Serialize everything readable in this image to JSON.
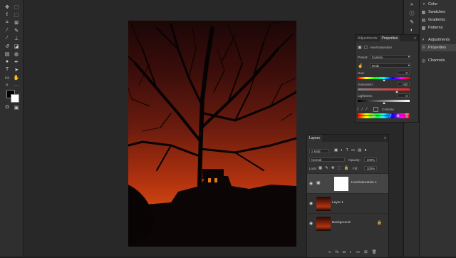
{
  "toolbar": {
    "tools": [
      "move",
      "marquee",
      "lasso",
      "object-select",
      "crop",
      "frame",
      "eyedropper",
      "healing",
      "brush",
      "stamp",
      "history-brush",
      "eraser",
      "gradient",
      "blur",
      "dodge",
      "pen",
      "type",
      "path-select",
      "rectangle",
      "hand",
      "zoom",
      "more"
    ]
  },
  "dock_strip": {
    "icons": [
      "collapse",
      "info",
      "brush-panel",
      "adjust",
      "layer-comps"
    ]
  },
  "dock": {
    "items": [
      {
        "label": "Color",
        "icon": "color-icon"
      },
      {
        "label": "Swatches",
        "icon": "swatches-icon"
      },
      {
        "label": "Gradients",
        "icon": "gradients-icon"
      },
      {
        "label": "Patterns",
        "icon": "patterns-icon"
      },
      {
        "label": "Adjustments",
        "icon": "adjustments-icon"
      },
      {
        "label": "Properties",
        "icon": "properties-icon"
      },
      {
        "label": "Channels",
        "icon": "channels-icon"
      }
    ]
  },
  "properties": {
    "tabs": [
      "Adjustments",
      "Properties"
    ],
    "layer_title": "Hue/Saturation",
    "preset_label": "Preset:",
    "preset_value": "Custom",
    "channel_value": "Reds",
    "hue_label": "Hue:",
    "hue_value": "0",
    "saturation_label": "Saturation:",
    "saturation_value": "+50",
    "lightness_label": "Lightness:",
    "lightness_value": "0",
    "colorize_label": "Colorize",
    "hue_pos": 0.5,
    "sat_pos": 0.75,
    "light_pos": 0.5
  },
  "layers": {
    "tab": "Layers",
    "filter_kind": "Kind",
    "blend_mode": "Normal",
    "opacity_label": "Opacity:",
    "opacity_value": "100%",
    "lock_label": "Lock:",
    "fill_label": "Fill:",
    "fill_value": "100%",
    "items": [
      {
        "name": "Hue/Saturation 1"
      },
      {
        "name": "Layer 1"
      },
      {
        "name": "Background"
      }
    ],
    "bottom_icons": [
      "link-icon",
      "fx-icon",
      "mask-icon",
      "adjustment-layer-icon",
      "group-icon",
      "new-layer-icon",
      "trash-icon"
    ]
  },
  "colors": {
    "sky_top": "#1b0707",
    "sky_bottom": "#d24a12",
    "panel_bg": "#323232",
    "canvas_bg": "#282828"
  }
}
